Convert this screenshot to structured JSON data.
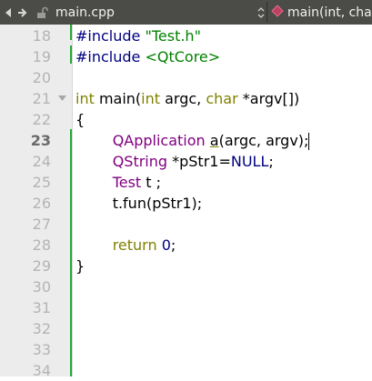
{
  "toolbar": {
    "file_name": "main.cpp",
    "symbol": "main(int, char"
  },
  "editor": {
    "current_line": "23",
    "lines": [
      {
        "number": "18",
        "tokens": [
          {
            "t": "#include ",
            "c": "pp"
          },
          {
            "t": "\"Test.h\"",
            "c": "str"
          }
        ]
      },
      {
        "number": "19",
        "tokens": [
          {
            "t": "#include ",
            "c": "pp"
          },
          {
            "t": "<QtCore>",
            "c": "str"
          }
        ]
      },
      {
        "number": "20",
        "tokens": []
      },
      {
        "number": "21",
        "tokens": [
          {
            "t": "int",
            "c": "kw"
          },
          {
            "t": " main(",
            "c": ""
          },
          {
            "t": "int",
            "c": "kw"
          },
          {
            "t": " argc, ",
            "c": ""
          },
          {
            "t": "char",
            "c": "kw"
          },
          {
            "t": " *argv[])",
            "c": ""
          }
        ]
      },
      {
        "number": "22",
        "tokens": [
          {
            "t": "{",
            "c": ""
          }
        ]
      },
      {
        "number": "23",
        "tokens": [
          {
            "t": "        ",
            "c": ""
          },
          {
            "t": "QApplication",
            "c": "type"
          },
          {
            "t": " ",
            "c": ""
          },
          {
            "t": "a",
            "c": "fn"
          },
          {
            "t": "(argc, argv);",
            "c": ""
          }
        ]
      },
      {
        "number": "24",
        "tokens": [
          {
            "t": "        ",
            "c": ""
          },
          {
            "t": "QString",
            "c": "type"
          },
          {
            "t": " *pStr1=",
            "c": ""
          },
          {
            "t": "NULL",
            "c": "pp"
          },
          {
            "t": ";",
            "c": ""
          }
        ]
      },
      {
        "number": "25",
        "tokens": [
          {
            "t": "        ",
            "c": ""
          },
          {
            "t": "Test",
            "c": "type"
          },
          {
            "t": " t ;",
            "c": ""
          }
        ]
      },
      {
        "number": "26",
        "tokens": [
          {
            "t": "        ",
            "c": ""
          },
          {
            "t": "t.fun(pStr1);",
            "c": ""
          }
        ]
      },
      {
        "number": "27",
        "tokens": []
      },
      {
        "number": "28",
        "tokens": [
          {
            "t": "        ",
            "c": ""
          },
          {
            "t": "return",
            "c": "kw"
          },
          {
            "t": " ",
            "c": ""
          },
          {
            "t": "0",
            "c": "num"
          },
          {
            "t": ";",
            "c": ""
          }
        ]
      },
      {
        "number": "29",
        "tokens": [
          {
            "t": "}",
            "c": ""
          }
        ]
      },
      {
        "number": "30",
        "tokens": []
      },
      {
        "number": "31",
        "tokens": []
      },
      {
        "number": "32",
        "tokens": []
      },
      {
        "number": "33",
        "tokens": []
      },
      {
        "number": "34",
        "tokens": []
      }
    ]
  },
  "colors": {
    "keyword": "#808000",
    "preprocessor": "#000080",
    "string": "#008000",
    "type": "#800080",
    "change_bar": "#22aa33"
  },
  "icons": {
    "back": "triangle-left-icon",
    "forward": "arrow-right-icon",
    "lock": "unlocked-padlock-icon",
    "dropdown": "chevron-up-down-icon",
    "symbol": "function-diamond-icon"
  }
}
